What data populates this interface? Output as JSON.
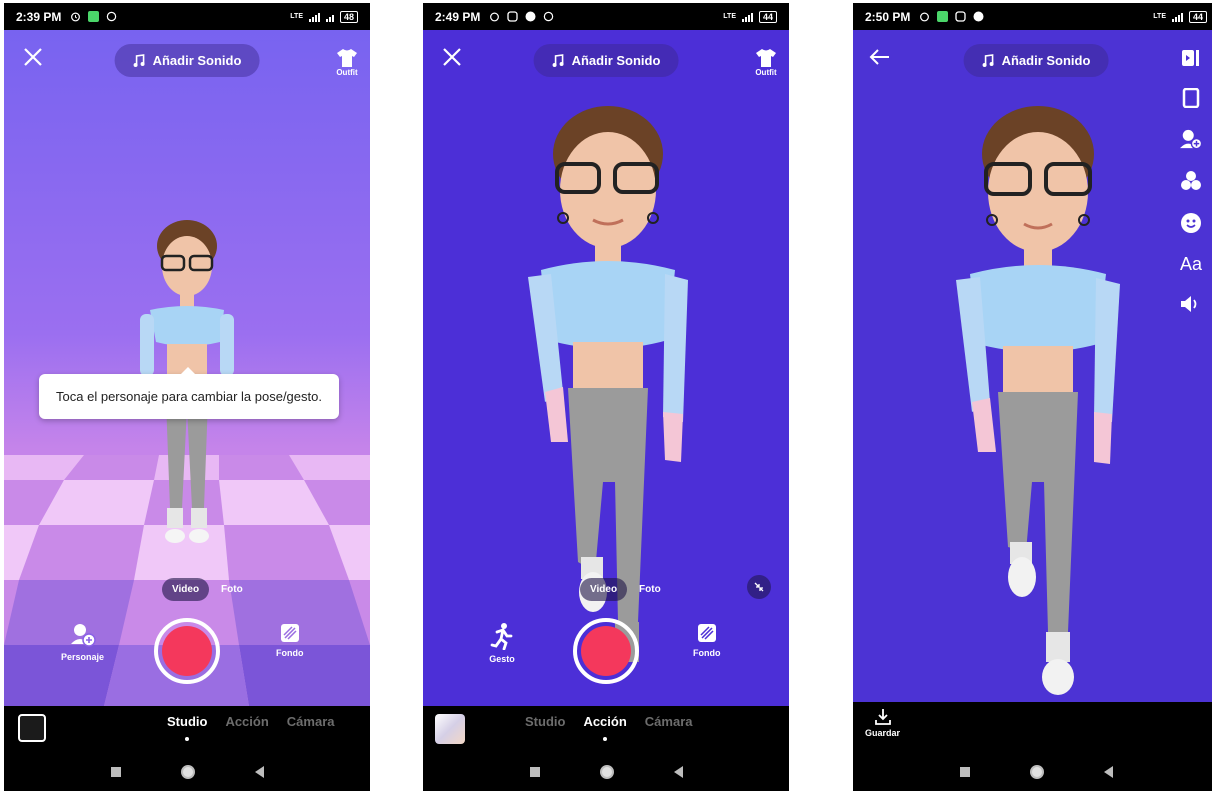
{
  "screens": [
    {
      "status_time": "2:39 PM",
      "battery": "48",
      "network": "LTE",
      "sound_label": "Añadir Sonido",
      "outfit_label": "Outfit",
      "tooltip": "Toca el personaje para cambiar la pose/gesto.",
      "mode_video": "Video",
      "mode_photo": "Foto",
      "left_tool_label": "Personaje",
      "right_tool_label": "Fondo",
      "tabs": [
        "Studio",
        "Acción",
        "Cámara"
      ],
      "active_tab": "Studio"
    },
    {
      "status_time": "2:49 PM",
      "battery": "44",
      "network": "LTE",
      "sound_label": "Añadir Sonido",
      "outfit_label": "Outfit",
      "mode_video": "Video",
      "mode_photo": "Foto",
      "left_tool_label": "Gesto",
      "right_tool_label": "Fondo",
      "tabs": [
        "Studio",
        "Acción",
        "Cámara"
      ],
      "active_tab": "Acción"
    },
    {
      "status_time": "2:50 PM",
      "battery": "44",
      "network": "LTE",
      "sound_label": "Añadir Sonido",
      "rail_text": "Aa",
      "save_label": "Guardar"
    }
  ],
  "colors": {
    "record": "#f4385c",
    "bg_screen2": "#4c2fd7",
    "bg_screen3": "#4c33d4"
  },
  "icons": {
    "close": "close-icon",
    "back": "arrow-left-icon",
    "music": "music-note-icon",
    "outfit": "tshirt-icon",
    "character": "character-add-icon",
    "gesture": "running-figure-icon",
    "background": "background-pattern-icon",
    "shrink": "collapse-icon",
    "save": "download-icon"
  }
}
